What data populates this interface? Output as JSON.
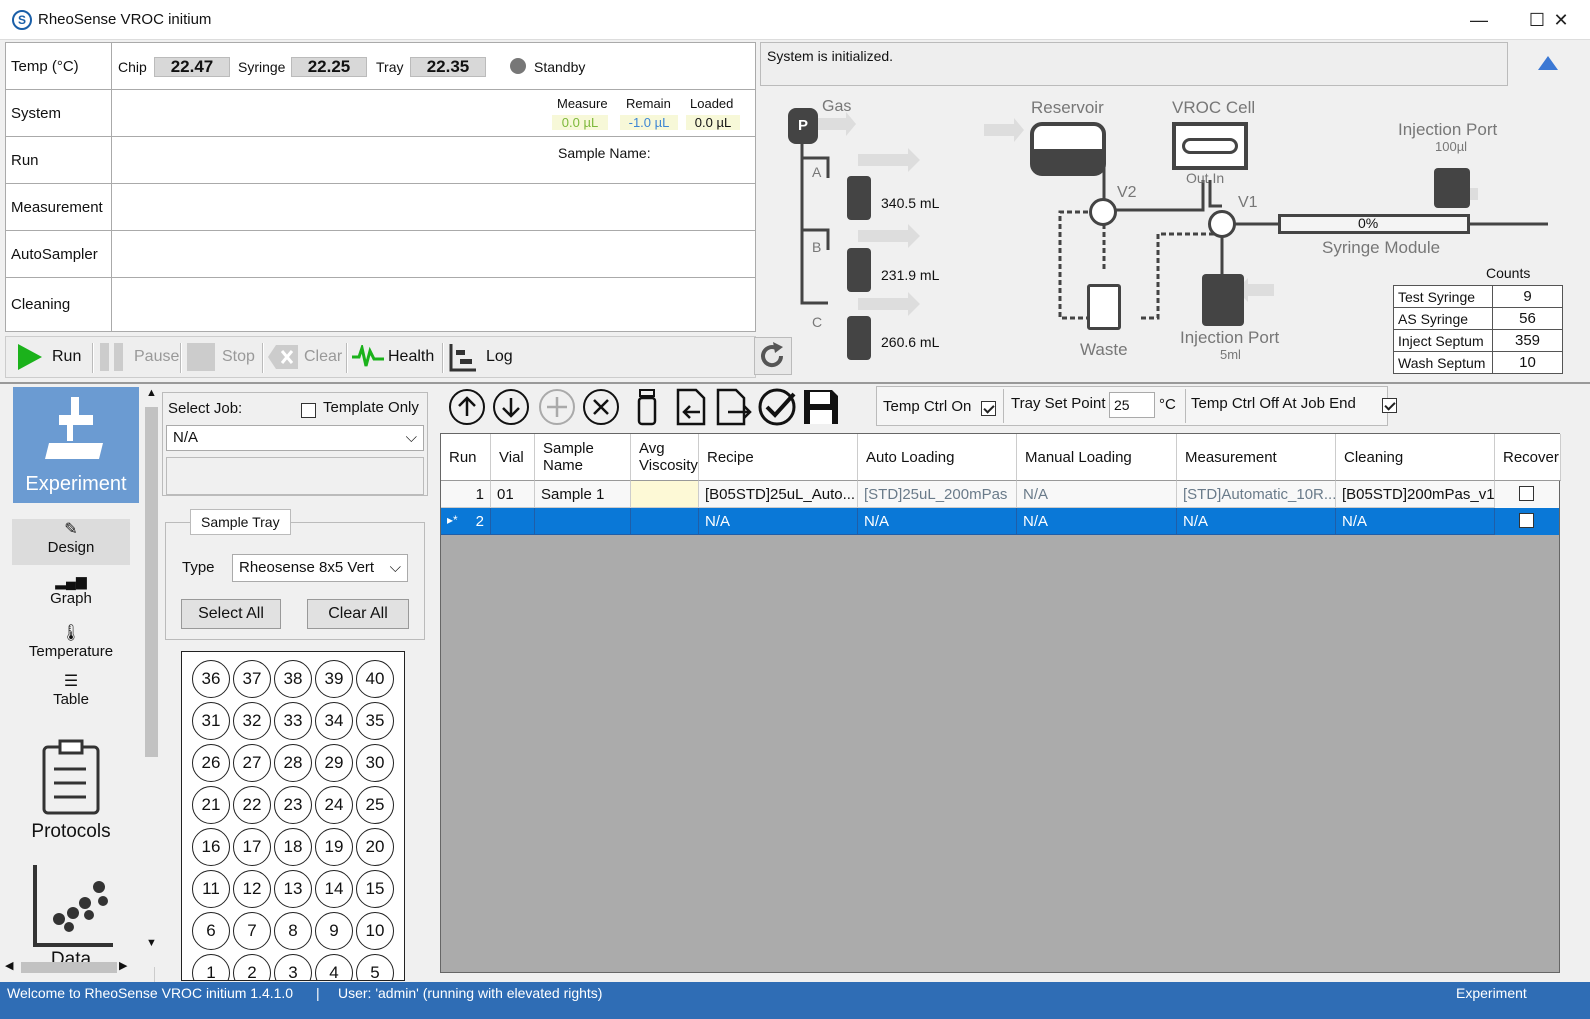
{
  "window": {
    "title": "RheoSense VROC initium",
    "app_icon": "S",
    "minimize": "—",
    "maximize": "☐",
    "close": "✕"
  },
  "status_panel": {
    "temp": {
      "label": "Temp (°C)",
      "chip_label": "Chip",
      "chip": "22.47",
      "syringe_label": "Syringe",
      "syringe": "22.25",
      "tray_label": "Tray",
      "tray": "22.35",
      "state": "Standby"
    },
    "system": {
      "label": "System",
      "measure_label": "Measure",
      "measure": "0.0 µL",
      "remain_label": "Remain",
      "remain": "-1.0 µL",
      "loaded_label": "Loaded",
      "loaded": "0.0  µL"
    },
    "run": {
      "label": "Run",
      "sample_name_label": "Sample Name:"
    },
    "measurement": {
      "label": "Measurement"
    },
    "autosampler": {
      "label": "AutoSampler"
    },
    "cleaning": {
      "label": "Cleaning"
    }
  },
  "message": "System is initialized.",
  "toolbar": {
    "run": "Run",
    "pause": "Pause",
    "stop": "Stop",
    "clear": "Clear",
    "health": "Health",
    "log": "Log"
  },
  "diagram": {
    "gas": "Gas",
    "pump": "P",
    "bottles": [
      {
        "label": "A",
        "volume": "340.5 mL"
      },
      {
        "label": "B",
        "volume": "231.9 mL"
      },
      {
        "label": "C",
        "volume": "260.6 mL"
      }
    ],
    "reservoir": "Reservoir",
    "vroc_cell": "VROC Cell",
    "out_in": "Out In",
    "v2": "V2",
    "v1": "V1",
    "waste": "Waste",
    "injection_port_small": "Injection Port",
    "injection_port_small_vol": "100µl",
    "injection_port_large": "Injection Port",
    "injection_port_large_vol": "5ml",
    "syringe_pct": "0%",
    "syringe_module": "Syringe Module"
  },
  "counts": {
    "title": "Counts",
    "rows": [
      {
        "label": "Test Syringe",
        "value": "9"
      },
      {
        "label": "AS Syringe",
        "value": "56"
      },
      {
        "label": "Inject Septum",
        "value": "359"
      },
      {
        "label": "Wash Septum",
        "value": "10"
      }
    ]
  },
  "nav": {
    "experiment": "Experiment",
    "design": "Design",
    "graph": "Graph",
    "temperature": "Temperature",
    "table": "Table",
    "protocols": "Protocols",
    "data": "Data"
  },
  "job": {
    "select_job_label": "Select Job:",
    "template_only": "Template Only",
    "job_value": "N/A",
    "sample_tray_title": "Sample Tray",
    "type_label": "Type",
    "type_value": "Rheosense 8x5 Vert",
    "select_all": "Select All",
    "clear_all": "Clear All"
  },
  "tray": {
    "rows": [
      [
        "36",
        "37",
        "38",
        "39",
        "40"
      ],
      [
        "31",
        "32",
        "33",
        "34",
        "35"
      ],
      [
        "26",
        "27",
        "28",
        "29",
        "30"
      ],
      [
        "21",
        "22",
        "23",
        "24",
        "25"
      ],
      [
        "16",
        "17",
        "18",
        "19",
        "20"
      ],
      [
        "11",
        "12",
        "13",
        "14",
        "15"
      ],
      [
        "6",
        "7",
        "8",
        "9",
        "10"
      ],
      [
        "1",
        "2",
        "3",
        "4",
        "5"
      ]
    ]
  },
  "temp_options": {
    "temp_ctrl_on": "Temp Ctrl On",
    "tray_set_point": "Tray Set Point",
    "set_point_value": "25",
    "unit": "°C",
    "temp_ctrl_off": "Temp Ctrl Off At Job End"
  },
  "grid": {
    "headers": [
      "Run",
      "Vial",
      "Sample Name",
      "Avg Viscosity",
      "Recipe",
      "Auto Loading",
      "Manual Loading",
      "Measurement",
      "Cleaning",
      "Recover"
    ],
    "rows": [
      {
        "run": "1",
        "vial": "01",
        "sample": "Sample 1",
        "visc": "",
        "recipe": "[B05STD]25uL_Auto...",
        "auto": "[STD]25uL_200mPas",
        "manual": "N/A",
        "measurement": "[STD]Automatic_10R...",
        "cleaning": "[B05STD]200mPas_v1"
      },
      {
        "marker": "▸*",
        "run": "2",
        "vial": "",
        "sample": "",
        "visc": "",
        "recipe": "N/A",
        "auto": "N/A",
        "manual": "N/A",
        "measurement": "N/A",
        "cleaning": "N/A"
      }
    ]
  },
  "statusbar": {
    "welcome": "Welcome to RheoSense VROC initium 1.4.1.0",
    "separator": "|",
    "user": "User: 'admin' (running with elevated rights)",
    "mode": "Experiment"
  },
  "colors": {
    "accent": "#6b9bd2",
    "selection": "#0a78d7",
    "statusbar": "#2f6db5",
    "run_green": "#1bb21b"
  }
}
